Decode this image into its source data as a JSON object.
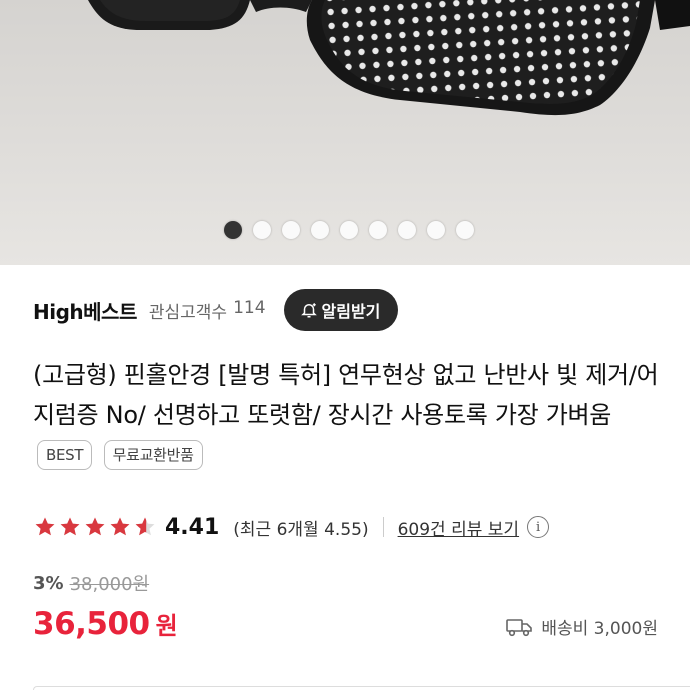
{
  "gallery": {
    "dot_count": 9,
    "active_index": 0
  },
  "seller": {
    "name": "High베스트",
    "followers_label": "관심고객수",
    "followers_count": "114",
    "notify_label": "알림받기"
  },
  "product": {
    "title": "(고급형) 핀홀안경 [발명 특허] 연무현상 없고 난반사 빛 제거/어지럼증 No/ 선명하고 또렷함/ 장시간 사용토록 가장 가벼움",
    "badges": [
      "BEST",
      "무료교환반품"
    ]
  },
  "rating": {
    "score": "4.41",
    "score_value": 4.41,
    "recent": "(최근 6개월 4.55)",
    "reviews_link": "609건 리뷰 보기",
    "info_glyph": "i"
  },
  "price": {
    "discount": "3%",
    "original": "38,000원",
    "current": "36,500",
    "unit": "원"
  },
  "shipping": {
    "label": "배송비 3,000원"
  },
  "colors": {
    "accent_red": "#e8233b",
    "star_red": "#d9383f",
    "button_dark": "#2a2a2a"
  }
}
